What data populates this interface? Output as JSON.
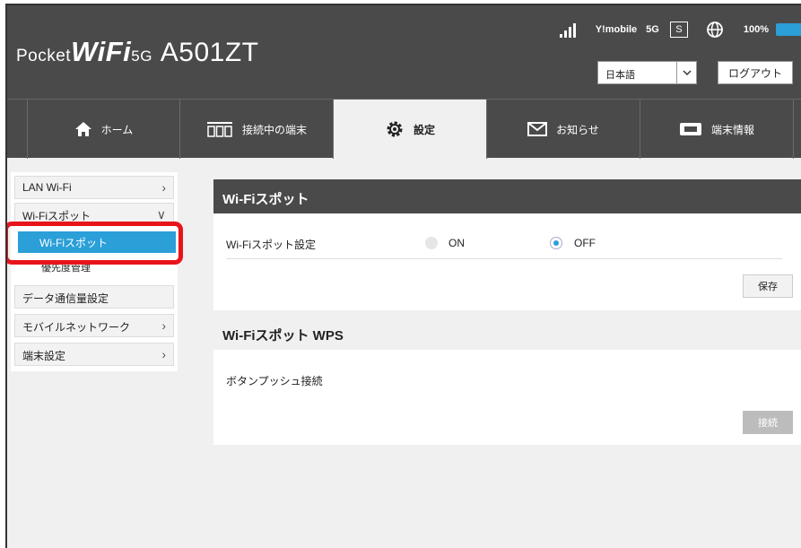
{
  "header": {
    "brand_pocket": "Pocket",
    "brand_wifi": "WiFi",
    "brand_5g": "5G",
    "brand_model": "A501ZT",
    "carrier": "Y!mobile",
    "network": "5G",
    "sim_badge": "S",
    "battery": "100%",
    "language_selected": "日本語",
    "logout_label": "ログアウト"
  },
  "tabs": [
    {
      "label": "ホーム",
      "icon": "home-icon"
    },
    {
      "label": "接続中の端末",
      "icon": "devices-icon"
    },
    {
      "label": "設定",
      "icon": "gear-icon",
      "active": true
    },
    {
      "label": "お知らせ",
      "icon": "mail-icon"
    },
    {
      "label": "端末情報",
      "icon": "device-info-icon"
    }
  ],
  "sidebar": {
    "items": [
      {
        "label": "LAN Wi-Fi"
      },
      {
        "label": "Wi-Fiスポット"
      },
      {
        "label": "データ通信量設定"
      },
      {
        "label": "モバイルネットワーク"
      },
      {
        "label": "端末設定"
      }
    ],
    "sub_active": "Wi-Fiスポット",
    "sub_second": "優先度管理"
  },
  "main": {
    "section1_title": "Wi-Fiスポット",
    "setting_label": "Wi-Fiスポット設定",
    "on_label": "ON",
    "off_label": "OFF",
    "selected": "OFF",
    "save_label": "保存",
    "section2_title": "Wi-Fiスポット WPS",
    "push_label": "ボタンプッシュ接続",
    "connect_label": "接続"
  },
  "colors": {
    "header_bg": "#4a4a4a",
    "accent": "#2a9fd8",
    "highlight": "#e8141c"
  }
}
